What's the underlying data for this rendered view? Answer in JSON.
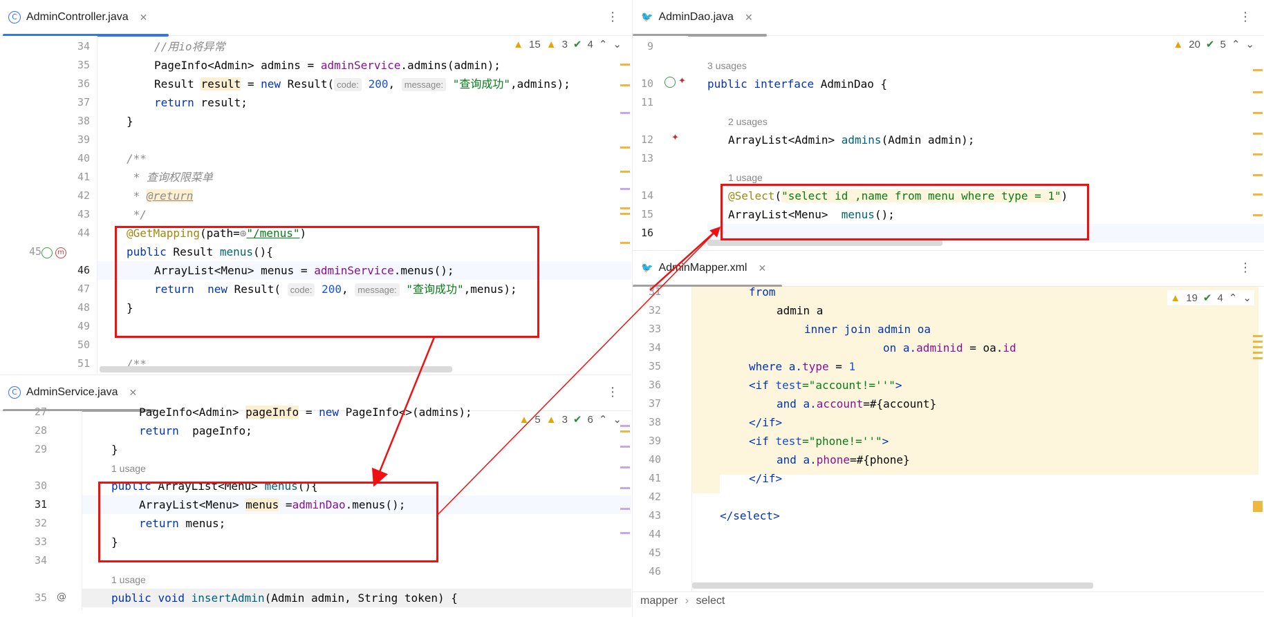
{
  "left_top": {
    "tab": "AdminController.java",
    "inspections": {
      "warnings": "15",
      "weak": "3",
      "ok": "4"
    },
    "lines": [
      {
        "n": "34"
      },
      {
        "n": "35"
      },
      {
        "n": "36"
      },
      {
        "n": "37"
      },
      {
        "n": "38"
      },
      {
        "n": "39"
      },
      {
        "n": "40"
      },
      {
        "n": "41"
      },
      {
        "n": "42"
      },
      {
        "n": "43"
      },
      {
        "n": "44"
      },
      {
        "n": "45"
      },
      {
        "n": "46"
      },
      {
        "n": "47"
      },
      {
        "n": "48"
      },
      {
        "n": "49"
      },
      {
        "n": "50"
      },
      {
        "n": "51"
      }
    ],
    "code": {
      "l34": "//用io将异常",
      "l35a": "PageInfo<Admin> admins = ",
      "l35b": "adminService",
      "l35c": ".admins(admin);",
      "l36a": "Result ",
      "l36b": "result",
      "l36c": " = ",
      "l36d": "new",
      "l36e": " Result(",
      "l36h1": "code:",
      "l36v1": "200",
      "l36h2": "message:",
      "l36s": "\"查询成功\"",
      "l36f": ",admins);",
      "l37a": "return",
      "l37b": " result;",
      "l38": "}",
      "l40": "/**",
      "l41": " * 查询权限菜单",
      "l42a": " * ",
      "l42b": "@return",
      "l43": " */",
      "l44a": "@GetMapping",
      "l44b": "(path=",
      "l44c": "\"/menus\"",
      "l44d": ")",
      "l45a": "public",
      "l45b": " Result ",
      "l45c": "menus",
      "l45d": "(){",
      "l46a": "ArrayList<Menu> menus = ",
      "l46b": "adminService",
      "l46c": ".menus();",
      "l47a": "return",
      "l47b": "  ",
      "l47c": "new",
      "l47d": " Result( ",
      "l47h1": "code:",
      "l47v1": "200",
      "l47h2": "message:",
      "l47s": "\"查询成功\"",
      "l47e": ",menus);",
      "l48": "}",
      "l51": "/**"
    }
  },
  "left_bottom": {
    "tab": "AdminService.java",
    "inspections": {
      "warnings": "5",
      "weak": "3",
      "ok": "6"
    },
    "lines": [
      {
        "n": "27"
      },
      {
        "n": "28"
      },
      {
        "n": "29"
      },
      {
        "n": "30"
      },
      {
        "n": "31"
      },
      {
        "n": "32"
      },
      {
        "n": "33"
      },
      {
        "n": "34"
      },
      {
        "n": "35"
      }
    ],
    "code": {
      "l27a": "PageInfo<Admin> ",
      "l27b": "pageInfo",
      "l27c": " = ",
      "l27d": "new",
      "l27e": " PageInfo<>(admins);",
      "l28a": "return",
      "l28b": "  pageInfo;",
      "l29": "}",
      "usage1": "1 usage",
      "l30a": "public",
      "l30b": " ArrayList<Menu> ",
      "l30c": "menus",
      "l30d": "(){",
      "l31a": "ArrayList<Menu> ",
      "l31b": "menus",
      "l31c": " =",
      "l31d": "adminDao",
      "l31e": ".menus();",
      "l32a": "return",
      "l32b": " menus;",
      "l33": "}",
      "usage2": "1 usage",
      "l35a": "public",
      "l35b": " ",
      "l35c": "void",
      "l35d": " ",
      "l35e": "insertAdmin",
      "l35f": "(Admin admin, String token) {"
    }
  },
  "right_top": {
    "tab": "AdminDao.java",
    "inspections": {
      "warnings": "20",
      "ok": "5"
    },
    "code": {
      "usage3": "3 usages",
      "l10a": "public",
      "l10b": " ",
      "l10c": "interface",
      "l10d": " AdminDao {",
      "usage2": "2 usages",
      "l12a": "ArrayList<Admin> ",
      "l12b": "admins",
      "l12c": "(Admin admin);",
      "usage1": "1 usage",
      "l14a": "@Select",
      "l14b": "(",
      "l14c": "\"select id ,name from menu where type = 1\"",
      "l14d": ")",
      "l15a": "ArrayList<Menu>  ",
      "l15b": "menus",
      "l15c": "();"
    }
  },
  "right_bottom": {
    "tab": "AdminMapper.xml",
    "inspections": {
      "warnings": "19",
      "ok": "4"
    },
    "code": {
      "l31": "from",
      "l32": "admin a",
      "l33": "inner join admin oa",
      "l34a": "on a.",
      "l34b": "adminid",
      "l34c": " = oa.",
      "l34d": "id",
      "l35a": "where a.",
      "l35b": "type",
      "l35c": " = ",
      "l35d": "1",
      "l36a": "<if ",
      "l36b": "test",
      "l36c": "=\"account!=''\"",
      "l36d": ">",
      "l37a": "and a.",
      "l37b": "account",
      "l37c": "=#{account}",
      "l38": "</if>",
      "l39a": "<if ",
      "l39b": "test",
      "l39c": "=\"phone!=''\"",
      "l39d": ">",
      "l40a": "and a.",
      "l40b": "phone",
      "l40c": "=#{phone}",
      "l41": "</if>",
      "l43": "</select>"
    }
  },
  "breadcrumb": {
    "item1": "mapper",
    "sep": "›",
    "item2": "select"
  },
  "colors": {
    "annotation_box": "#f01010",
    "accent": "#3574f0"
  }
}
